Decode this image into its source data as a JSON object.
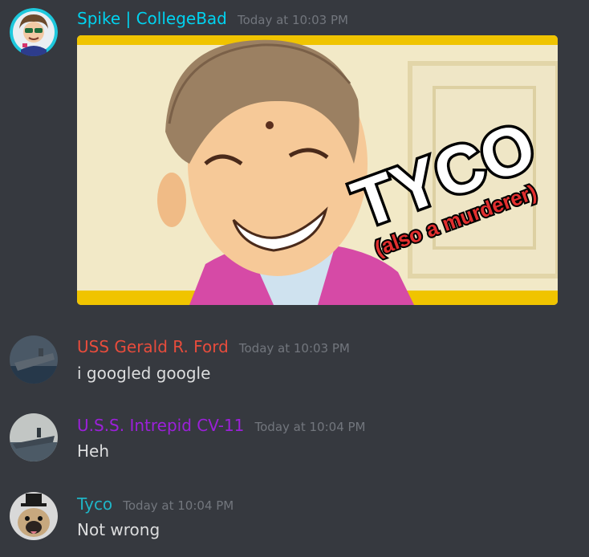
{
  "messages": [
    {
      "username": "Spike | CollegeBad",
      "timestamp": "Today at 10:03 PM",
      "name_color": "#00d3f0",
      "image": {
        "caption_title": "TYCO",
        "caption_sub": "(also a murderer)"
      }
    },
    {
      "username": "USS Gerald R. Ford",
      "timestamp": "Today at 10:03 PM",
      "name_color": "#e74c3c",
      "text": "i googled google"
    },
    {
      "username": "U.S.S. Intrepid CV-11",
      "timestamp": "Today at 10:04 PM",
      "name_color": "#9b20d9",
      "text": "Heh"
    },
    {
      "username": "Tyco",
      "timestamp": "Today at 10:04 PM",
      "name_color": "#1fb5c6",
      "text": "Not wrong"
    }
  ]
}
